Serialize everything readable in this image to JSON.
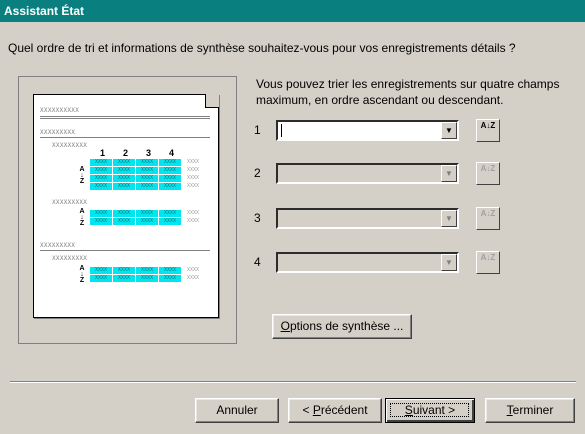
{
  "window": {
    "title": "Assistant État"
  },
  "question": "Quel ordre de tri et informations de synthèse souhaitez-vous pour vos enregistrements détails ?",
  "info_text": "Vous pouvez trier les enregistrements sur quatre champs maximum, en ordre ascendant ou descendant.",
  "preview": {
    "header_text": "XXXXXXXXXX",
    "group_text": "XXXXXXXXX",
    "subgroup_text": "XXXXXXXXX",
    "column_numbers": [
      "1",
      "2",
      "3",
      "4"
    ],
    "cell_text": "XXXX",
    "sort_top": "A",
    "sort_bottom": "Z"
  },
  "sort_fields": [
    {
      "number": "1",
      "value": "",
      "enabled": true
    },
    {
      "number": "2",
      "value": "",
      "enabled": false
    },
    {
      "number": "3",
      "value": "",
      "enabled": false
    },
    {
      "number": "4",
      "value": "",
      "enabled": false
    }
  ],
  "sort_button_label": "A↓Z",
  "options_button": {
    "mnemonic": "O",
    "rest": "ptions de synthèse ..."
  },
  "buttons": {
    "cancel": "Annuler",
    "previous_prefix": "< ",
    "previous_mnemonic": "P",
    "previous_rest": "récédent",
    "next_mnemonic": "S",
    "next_rest": "uivant >",
    "finish_mnemonic": "T",
    "finish_rest": "erminer"
  },
  "colors": {
    "title_bar": "#0a7f7f",
    "dialog_bg": "#d4d0c8",
    "preview_highlight": "#00e5ee"
  }
}
